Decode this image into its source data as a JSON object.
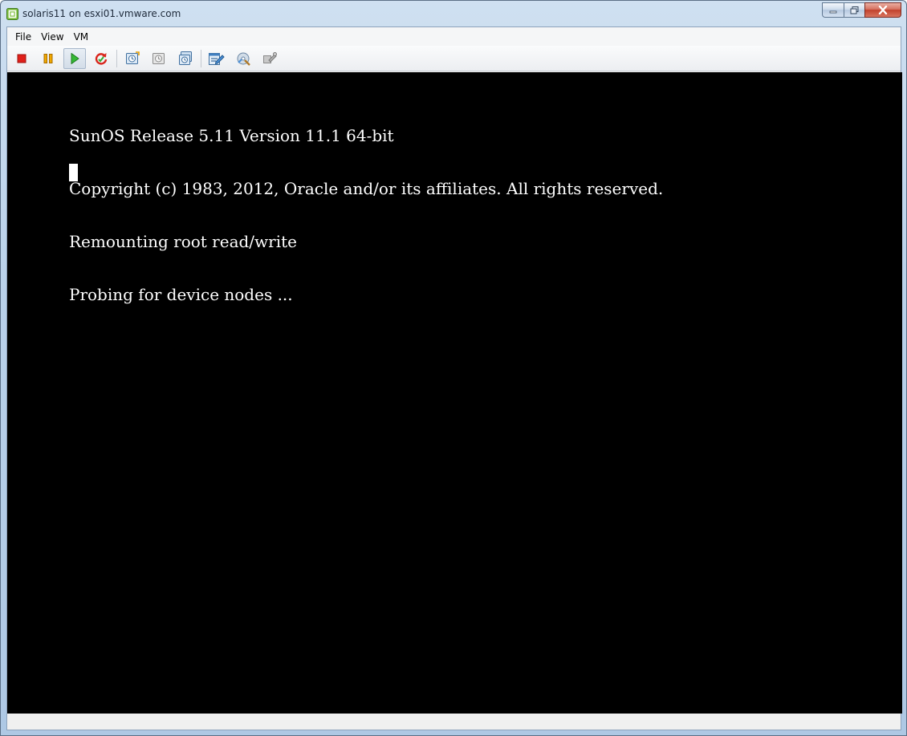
{
  "window": {
    "title": "solaris11 on esxi01.vmware.com"
  },
  "menubar": {
    "items": [
      "File",
      "View",
      "VM"
    ]
  },
  "toolbar": {
    "buttons": [
      {
        "icon": "power-off-icon",
        "color": "#e0201a"
      },
      {
        "icon": "suspend-icon",
        "color": "#e8a000"
      },
      {
        "icon": "power-on-icon",
        "color": "#2fae2f",
        "pressed": true
      },
      {
        "icon": "reset-icon",
        "color": "#d9261c"
      },
      {
        "icon": "snapshot-take-icon"
      },
      {
        "icon": "snapshot-revert-icon"
      },
      {
        "icon": "snapshot-manager-icon"
      },
      {
        "icon": "edit-settings-icon"
      },
      {
        "icon": "connect-devices-icon"
      },
      {
        "icon": "vm-tools-icon"
      }
    ]
  },
  "console": {
    "background": "#000000",
    "foreground": "#ffffff",
    "lines": [
      "SunOS Release 5.11 Version 11.1 64-bit",
      "Copyright (c) 1983, 2012, Oracle and/or its affiliates. All rights reserved.",
      "Remounting root read/write",
      "Probing for device nodes ..."
    ]
  }
}
